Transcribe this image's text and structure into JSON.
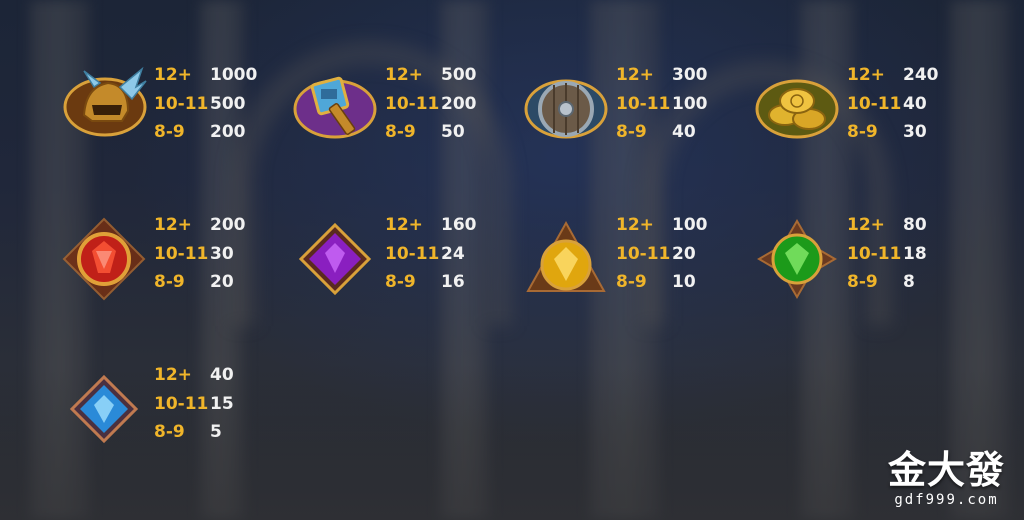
{
  "paytable": [
    {
      "symbol": "helmet-icon",
      "rows": [
        {
          "count": "12+",
          "pay": "1000"
        },
        {
          "count": "10-11",
          "pay": "500"
        },
        {
          "count": "8-9",
          "pay": "200"
        }
      ]
    },
    {
      "symbol": "hammer-icon",
      "rows": [
        {
          "count": "12+",
          "pay": "500"
        },
        {
          "count": "10-11",
          "pay": "200"
        },
        {
          "count": "8-9",
          "pay": "50"
        }
      ]
    },
    {
      "symbol": "shield-icon",
      "rows": [
        {
          "count": "12+",
          "pay": "300"
        },
        {
          "count": "10-11",
          "pay": "100"
        },
        {
          "count": "8-9",
          "pay": "40"
        }
      ]
    },
    {
      "symbol": "gold-coins-icon",
      "rows": [
        {
          "count": "12+",
          "pay": "240"
        },
        {
          "count": "10-11",
          "pay": "40"
        },
        {
          "count": "8-9",
          "pay": "30"
        }
      ]
    },
    {
      "symbol": "red-gem-icon",
      "rows": [
        {
          "count": "12+",
          "pay": "200"
        },
        {
          "count": "10-11",
          "pay": "30"
        },
        {
          "count": "8-9",
          "pay": "20"
        }
      ]
    },
    {
      "symbol": "purple-gem-icon",
      "rows": [
        {
          "count": "12+",
          "pay": "160"
        },
        {
          "count": "10-11",
          "pay": "24"
        },
        {
          "count": "8-9",
          "pay": "16"
        }
      ]
    },
    {
      "symbol": "yellow-gem-icon",
      "rows": [
        {
          "count": "12+",
          "pay": "100"
        },
        {
          "count": "10-11",
          "pay": "20"
        },
        {
          "count": "8-9",
          "pay": "10"
        }
      ]
    },
    {
      "symbol": "green-gem-icon",
      "rows": [
        {
          "count": "12+",
          "pay": "80"
        },
        {
          "count": "10-11",
          "pay": "18"
        },
        {
          "count": "8-9",
          "pay": "8"
        }
      ]
    },
    {
      "symbol": "blue-gem-icon",
      "rows": [
        {
          "count": "12+",
          "pay": "40"
        },
        {
          "count": "10-11",
          "pay": "15"
        },
        {
          "count": "8-9",
          "pay": "5"
        }
      ]
    }
  ],
  "watermark": {
    "chinese": "金大發",
    "url": "gdf999.com"
  },
  "colors": {
    "count": "#f0b52a",
    "pay": "#f1f1f1"
  }
}
